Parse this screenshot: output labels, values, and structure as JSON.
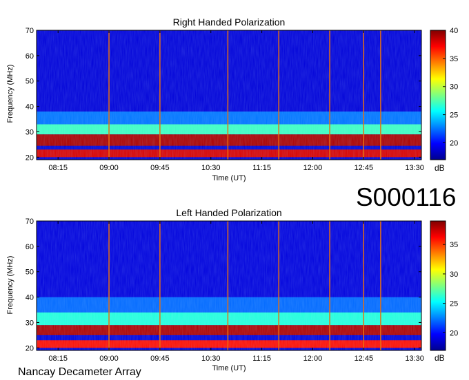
{
  "chart_data": [
    {
      "type": "heatmap",
      "title": "Right Handed Polarization",
      "xlabel": "Time (UT)",
      "ylabel": "Frequency (MHz)",
      "x_ticks": [
        "08:15",
        "09:00",
        "09:45",
        "10:30",
        "11:15",
        "12:00",
        "12:45",
        "13:30"
      ],
      "x_range": [
        "07:56",
        "13:36"
      ],
      "y_ticks": [
        20,
        30,
        40,
        50,
        60,
        70
      ],
      "ylim": [
        19,
        70
      ],
      "colorbar": {
        "ticks": [
          20,
          25,
          30,
          35,
          40
        ],
        "range": [
          17,
          40
        ],
        "unit": "dB"
      },
      "marker_lines_ut": [
        "09:00",
        "09:45",
        "10:45",
        "11:30",
        "12:15",
        "12:45",
        "13:00"
      ],
      "bands": [
        {
          "freq_mhz": [
            20,
            23
          ],
          "level_db": 38
        },
        {
          "freq_mhz": [
            24.5,
            29
          ],
          "level_db": 39
        },
        {
          "freq_mhz": [
            29,
            33
          ],
          "level_db": 27
        },
        {
          "freq_mhz": [
            33,
            38
          ],
          "level_db": 22.5
        },
        {
          "freq_mhz": [
            38,
            70
          ],
          "level_db": 19
        }
      ]
    },
    {
      "type": "heatmap",
      "title": "Left Handed Polarization",
      "xlabel": "Time (UT)",
      "ylabel": "Frequency (MHz)",
      "x_ticks": [
        "08:15",
        "09:00",
        "09:45",
        "10:30",
        "11:15",
        "12:00",
        "12:45",
        "13:30"
      ],
      "x_range": [
        "07:56",
        "13:36"
      ],
      "y_ticks": [
        20,
        30,
        40,
        50,
        60,
        70
      ],
      "ylim": [
        19,
        70
      ],
      "colorbar": {
        "ticks": [
          20,
          25,
          30,
          35
        ],
        "range": [
          17,
          39
        ],
        "unit": "dB"
      },
      "marker_lines_ut": [
        "09:00",
        "09:45",
        "10:45",
        "11:30",
        "12:15",
        "12:45",
        "13:00"
      ],
      "bands": [
        {
          "freq_mhz": [
            20,
            23
          ],
          "level_db": 36
        },
        {
          "freq_mhz": [
            25,
            29
          ],
          "level_db": 38
        },
        {
          "freq_mhz": [
            29,
            34
          ],
          "level_db": 26
        },
        {
          "freq_mhz": [
            34,
            40
          ],
          "level_db": 22
        },
        {
          "freq_mhz": [
            40,
            70
          ],
          "level_db": 19
        }
      ]
    }
  ],
  "dataset_id": "S000116",
  "instrument": "Nancay Decameter Array"
}
